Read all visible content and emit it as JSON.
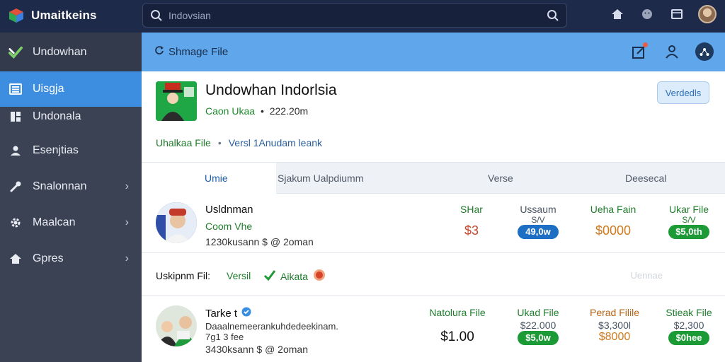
{
  "app": {
    "name": "Umaitkeins"
  },
  "search": {
    "placeholder": "Indovsian"
  },
  "sidebar": {
    "header": "Undowhan",
    "items": [
      {
        "label": "Uisgja",
        "icon": "list-icon",
        "active": true,
        "chevron": false
      },
      {
        "label": "Undonala",
        "icon": "grid-icon",
        "active": false,
        "chevron": false
      },
      {
        "label": "Esenjtias",
        "icon": "user-icon",
        "active": false,
        "chevron": false
      },
      {
        "label": "Snalonnan",
        "icon": "wrench-icon",
        "active": false,
        "chevron": true
      },
      {
        "label": "Maalcan",
        "icon": "gear-icon",
        "active": false,
        "chevron": true
      },
      {
        "label": "Gpres",
        "icon": "home-icon",
        "active": false,
        "chevron": true
      }
    ]
  },
  "subheader": {
    "title": "Shmage File"
  },
  "app_card": {
    "title": "Undowhan Indorlsia",
    "meta_green": "Caon Ukaa",
    "meta_sep": "•",
    "meta_value": "222.20m",
    "verify_label": "Verdedls",
    "link1": "Uhalkaa File",
    "link_sep": "•",
    "link2": "Versl 1Anudam leank"
  },
  "tabs": [
    {
      "label": "Umie",
      "active": true
    },
    {
      "label": "Sjakum Ualpdiumm",
      "active": false
    },
    {
      "label": "Verse",
      "active": false
    },
    {
      "label": "Deesecal",
      "active": false
    }
  ],
  "rows": [
    {
      "name": "Usldnman",
      "sub": "Coom Vhe",
      "meta": "1230kusann  $ @ 2oman",
      "cols": [
        {
          "header": "SHar",
          "value": "$3"
        },
        {
          "header": "Ussaum",
          "header2": "S/V",
          "pill": "49,0w"
        },
        {
          "header": "Ueha Fain",
          "value": "$0000"
        },
        {
          "header": "Ukar File",
          "header2": "S/V",
          "pill": "$5,0th"
        }
      ]
    },
    {
      "name": "Tarke t",
      "sub": "Daaalnemeerankuhdedeekinam. 7g1 3 fee",
      "meta": "3430ksann  $ @ 2oman",
      "cols": [
        {
          "header": "Natolura File",
          "value": "$1.00"
        },
        {
          "header": "Ukad File",
          "header2": "$22.000",
          "pill": "$5,0w"
        },
        {
          "header": "Perad Filile",
          "header2": "$3,300l",
          "value": "$8000"
        },
        {
          "header": "Stieak File",
          "header2": "$2,300",
          "pill": "$0hee"
        }
      ]
    }
  ],
  "action_row": {
    "label1": "Uskipnm  Fil:",
    "label2": "Versil",
    "label3": "Aikata",
    "ghost": "Uennae"
  }
}
